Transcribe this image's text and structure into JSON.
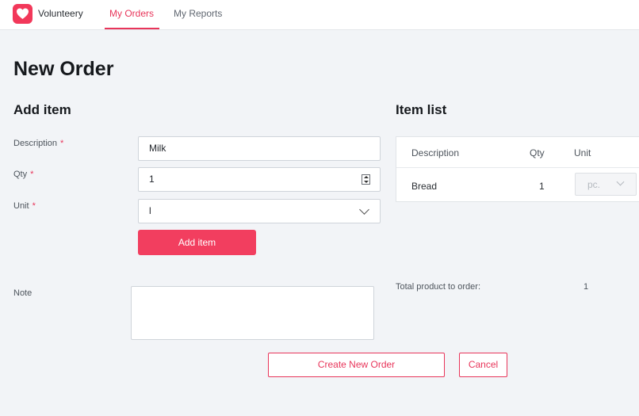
{
  "app": {
    "name": "Volunteery"
  },
  "nav": {
    "tabs": [
      {
        "label": "My Orders",
        "active": true
      },
      {
        "label": "My Reports",
        "active": false
      }
    ]
  },
  "page": {
    "title": "New Order"
  },
  "add_item": {
    "title": "Add item",
    "required_mark": "*",
    "fields": {
      "description": {
        "label": "Description",
        "value": "Milk"
      },
      "qty": {
        "label": "Qty",
        "value": "1"
      },
      "unit": {
        "label": "Unit",
        "value": "l"
      }
    },
    "button": "Add item"
  },
  "note": {
    "label": "Note",
    "value": ""
  },
  "item_list": {
    "title": "Item list",
    "columns": [
      "Description",
      "Qty",
      "Unit"
    ],
    "rows": [
      {
        "description": "Bread",
        "qty": "1",
        "unit": "pc."
      }
    ]
  },
  "total": {
    "label": "Total product to order:",
    "value": "1"
  },
  "actions": {
    "create": "Create New Order",
    "cancel": "Cancel"
  },
  "colors": {
    "accent": "#e8355a",
    "primary_button": "#f23e5f",
    "background": "#f2f4f7"
  }
}
